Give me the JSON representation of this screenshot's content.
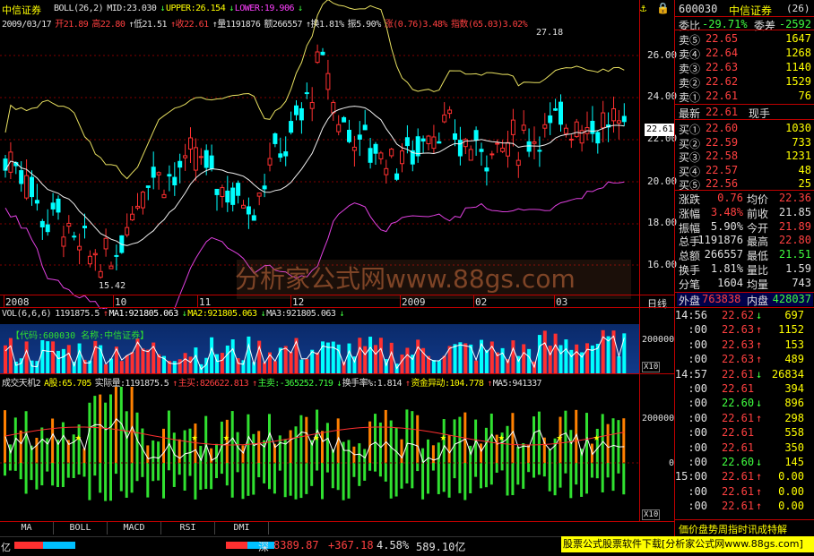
{
  "main": {
    "title": "中信证券",
    "indicator_line": [
      {
        "text": "BOLL(26,2)",
        "color": "#e0e0e0"
      },
      {
        "text": "MID:23.030",
        "color": "#e0e0e0"
      },
      {
        "text": "↓",
        "color": "#40ff40"
      },
      {
        "text": "UPPER:26.154",
        "color": "#ffff00"
      },
      {
        "text": "↓",
        "color": "#40ff40"
      },
      {
        "text": "LOWER:19.906",
        "color": "#ff40ff"
      },
      {
        "text": "↓",
        "color": "#40ff40"
      }
    ],
    "info_line": [
      {
        "text": "2009/03/17",
        "color": "#e0e0e0"
      },
      {
        "text": "开21.89",
        "color": "#ff4040"
      },
      {
        "text": "高22.80",
        "color": "#ff4040"
      },
      {
        "text": "↑低21.51",
        "color": "#e0e0e0"
      },
      {
        "text": "↑收22.61",
        "color": "#ff4040"
      },
      {
        "text": "↑量1191876",
        "color": "#e0e0e0"
      },
      {
        "text": "额266557",
        "color": "#e0e0e0"
      },
      {
        "text": "↑换1.81%",
        "color": "#e0e0e0"
      },
      {
        "text": "振5.90%",
        "color": "#e0e0e0"
      },
      {
        "text": "涨(0.76)3.48%",
        "color": "#ff4040"
      },
      {
        "text": "指数(65.03)3.02%",
        "color": "#ff4040"
      }
    ],
    "peak_label": "27.18",
    "low_label": "15.42",
    "watermark": "分析家公式网www.88gs.com",
    "y_labels": [
      "26.00",
      "24.00",
      "22.00",
      "20.00",
      "18.00",
      "16.00"
    ],
    "price_tag": "22.61",
    "x_labels": [
      "2008",
      "10",
      "11",
      "12",
      "2009",
      "02",
      "03"
    ],
    "daily_label": "日线"
  },
  "volume": {
    "line": [
      {
        "text": "VOL(6,6,6)",
        "color": "#e0e0e0"
      },
      {
        "text": "1191875.5",
        "color": "#e0e0e0"
      },
      {
        "text": "↑",
        "color": "#ff4040"
      },
      {
        "text": "MA1:921805.063",
        "color": "#ffffff"
      },
      {
        "text": "↓",
        "color": "#40ff40"
      },
      {
        "text": "MA2:921805.063",
        "color": "#ffff00"
      },
      {
        "text": "↓",
        "color": "#40ff40"
      },
      {
        "text": "MA3:921805.063",
        "color": "#e0e0e0"
      },
      {
        "text": "↓",
        "color": "#40ff40"
      }
    ],
    "code_banner": "【代码:600030 名称:中信证券】",
    "y_label": "200000",
    "unit": "X10"
  },
  "indicator2": {
    "line": [
      {
        "text": "成交天机2",
        "color": "#e0e0e0"
      },
      {
        "text": "A股:65.705",
        "color": "#ffff00"
      },
      {
        "text": "实际量:1191875.5",
        "color": "#e0e0e0"
      },
      {
        "text": "↑",
        "color": "#ff4040"
      },
      {
        "text": "主买:826622.813",
        "color": "#ff4040"
      },
      {
        "text": "↑",
        "color": "#ff4040"
      },
      {
        "text": "主卖:-365252.719",
        "color": "#40ff40"
      },
      {
        "text": "↓",
        "color": "#40ff40"
      },
      {
        "text": "换手率%:1.814",
        "color": "#e0e0e0"
      },
      {
        "text": "↑",
        "color": "#ff4040"
      },
      {
        "text": "资金异动:104.778",
        "color": "#ffff00"
      },
      {
        "text": "↑",
        "color": "#ff4040"
      },
      {
        "text": "MA5:941337",
        "color": "#e0e0e0"
      }
    ],
    "y_labels": [
      "200000",
      "0",
      "-200000"
    ],
    "unit": "X10"
  },
  "tabs": [
    "MA",
    "BOLL",
    "MACD",
    "RSI",
    "DMI"
  ],
  "status_bar": {
    "left_unit": "亿",
    "index_name": "深",
    "index_value": "8389.87",
    "index_change": "+367.18",
    "index_pct": "4.58%",
    "amount": "589.10亿",
    "link": "股票公式股票软件下载[分析家公式网www.88gs.com]"
  },
  "quote": {
    "code": "600030",
    "name": "中信证券",
    "code_num": "(26)",
    "ratio_label": "委比",
    "ratio_value": "-29.71%",
    "diff_label": "委差",
    "diff_value": "-2592",
    "asks": [
      {
        "label": "卖⑤",
        "price": "22.65",
        "vol": "1647"
      },
      {
        "label": "卖④",
        "price": "22.64",
        "vol": "1268"
      },
      {
        "label": "卖③",
        "price": "22.63",
        "vol": "1140"
      },
      {
        "label": "卖②",
        "price": "22.62",
        "vol": "1529"
      },
      {
        "label": "卖①",
        "price": "22.61",
        "vol": "76"
      }
    ],
    "last_label": "最新",
    "last_value": "22.61",
    "hand_label": "现手",
    "bids": [
      {
        "label": "买①",
        "price": "22.60",
        "vol": "1030"
      },
      {
        "label": "买②",
        "price": "22.59",
        "vol": "733"
      },
      {
        "label": "买③",
        "price": "22.58",
        "vol": "1231"
      },
      {
        "label": "买④",
        "price": "22.57",
        "vol": "48"
      },
      {
        "label": "买⑤",
        "price": "22.56",
        "vol": "25"
      }
    ],
    "stats": [
      {
        "l1": "涨跌",
        "v1": "0.76",
        "c1": "#ff4040",
        "l2": "均价",
        "v2": "22.36",
        "c2": "#ff4040"
      },
      {
        "l1": "涨幅",
        "v1": "3.48%",
        "c1": "#ff4040",
        "l2": "前收",
        "v2": "21.85",
        "c2": "#e0e0e0"
      },
      {
        "l1": "振幅",
        "v1": "5.90%",
        "c1": "#e0e0e0",
        "l2": "今开",
        "v2": "21.89",
        "c2": "#ff4040"
      },
      {
        "l1": "总手",
        "v1": "1191876",
        "c1": "#e0e0e0",
        "l2": "最高",
        "v2": "22.80",
        "c2": "#ff4040"
      },
      {
        "l1": "总额",
        "v1": "266557",
        "c1": "#e0e0e0",
        "l2": "最低",
        "v2": "21.51",
        "c2": "#40ff40"
      },
      {
        "l1": "换手",
        "v1": "1.81%",
        "c1": "#e0e0e0",
        "l2": "量比",
        "v2": "1.59",
        "c2": "#e0e0e0"
      },
      {
        "l1": "分笔",
        "v1": "1604",
        "c1": "#e0e0e0",
        "l2": "均量",
        "v2": "743",
        "c2": "#e0e0e0"
      }
    ],
    "outer_label": "外盘",
    "outer_value": "763838",
    "inner_label": "内盘",
    "inner_value": "428037",
    "ticks": [
      {
        "time": "14:56",
        "price": "22.62",
        "dir": "↓",
        "vol": "697"
      },
      {
        "time": ":00",
        "price": "22.63",
        "dir": "↑",
        "vol": "1152"
      },
      {
        "time": ":00",
        "price": "22.63",
        "dir": "↑",
        "vol": "153"
      },
      {
        "time": ":00",
        "price": "22.63",
        "dir": "↑",
        "vol": "489"
      },
      {
        "time": "14:57",
        "price": "22.61",
        "dir": "↓",
        "vol": "26834"
      },
      {
        "time": ":00",
        "price": "22.61",
        "dir": "",
        "vol": "394"
      },
      {
        "time": ":00",
        "price": "22.60",
        "dir": "↓",
        "vol": "896"
      },
      {
        "time": ":00",
        "price": "22.61",
        "dir": "↑",
        "vol": "298"
      },
      {
        "time": ":00",
        "price": "22.61",
        "dir": "",
        "vol": "558"
      },
      {
        "time": ":00",
        "price": "22.61",
        "dir": "",
        "vol": "350"
      },
      {
        "time": ":00",
        "price": "22.60",
        "dir": "↓",
        "vol": "145"
      },
      {
        "time": "15:00",
        "price": "22.61",
        "dir": "↑",
        "vol": "0.00"
      },
      {
        "time": ":00",
        "price": "22.61",
        "dir": "↑",
        "vol": "0.00"
      },
      {
        "time": ":00",
        "price": "22.61",
        "dir": "↑",
        "vol": "0.00"
      }
    ],
    "bottom_text": "価价盘势周指时讯成特解"
  },
  "colors": {
    "up": "#ff3030",
    "down": "#00ffff",
    "green": "#30e030",
    "orange": "#ff8000",
    "upper": "#e8e060",
    "lower": "#e040e0",
    "mid": "#f0f0f0"
  }
}
